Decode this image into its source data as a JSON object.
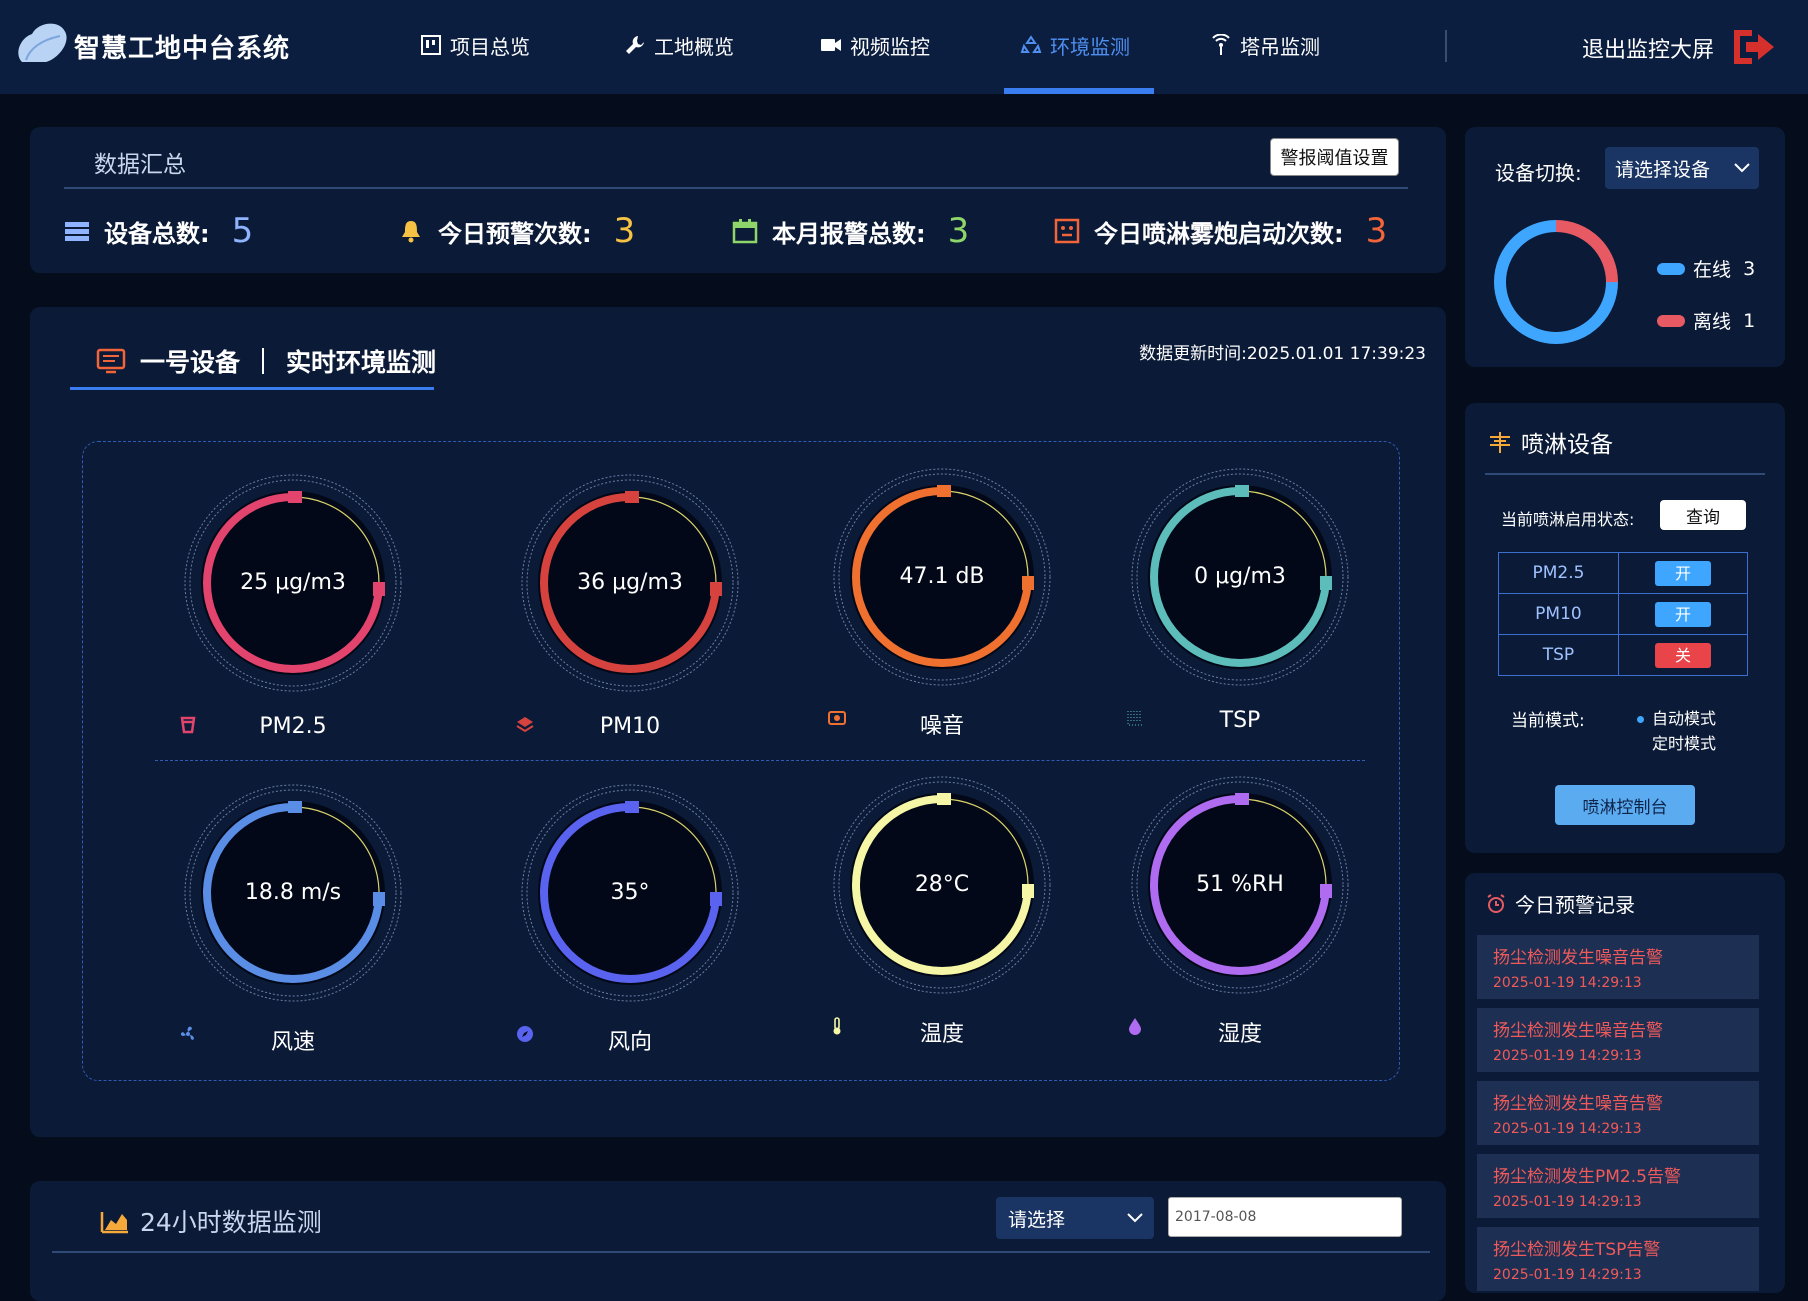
{
  "app": {
    "title": "智慧工地中台系统"
  },
  "nav": [
    {
      "label": "项目总览",
      "icon": "board-icon",
      "active": false
    },
    {
      "label": "工地概览",
      "icon": "wrench-icon",
      "active": false
    },
    {
      "label": "视频监控",
      "icon": "video-icon",
      "active": false
    },
    {
      "label": "环境监测",
      "icon": "recycle-icon",
      "active": true
    },
    {
      "label": "塔吊监测",
      "icon": "signal-icon",
      "active": false
    }
  ],
  "exit_label": "退出监控大屏",
  "summary": {
    "title": "数据汇总",
    "threshold_button": "警报阈值设置",
    "stats": [
      {
        "label": "设备总数:",
        "value": "5",
        "color": "#8fb3ff",
        "icon": "list-icon"
      },
      {
        "label": "今日预警次数:",
        "value": "3",
        "color": "#f6c244",
        "icon": "bell-icon"
      },
      {
        "label": "本月报警总数:",
        "value": "3",
        "color": "#8ed66a",
        "icon": "calendar-icon"
      },
      {
        "label": "今日喷淋雾炮启动次数:",
        "value": "3",
        "color": "#f2653b",
        "icon": "face-icon"
      }
    ]
  },
  "monitor": {
    "device": "一号设备",
    "title": "实时环境监测",
    "update_time": "数据更新时间:2025.01.01 17:39:23",
    "gauges": [
      {
        "value": "25 μg/m3",
        "label": "PM2.5",
        "color": "#e2446e",
        "icon": "cup-icon"
      },
      {
        "value": "36 μg/m3",
        "label": "PM10",
        "color": "#d6433f",
        "icon": "layers-icon"
      },
      {
        "value": "47.1 dB",
        "label": "噪音",
        "color": "#f0702f",
        "icon": "speaker-icon"
      },
      {
        "value": "0 μg/m3",
        "label": "TSP",
        "color": "#5dbdbb",
        "icon": "grid-icon"
      },
      {
        "value": "18.8  m/s",
        "label": "风速",
        "color": "#5a8ee6",
        "icon": "fan-icon"
      },
      {
        "value": "35°",
        "label": "风向",
        "color": "#5a63ef",
        "icon": "compass-icon"
      },
      {
        "value": "28°C",
        "label": "温度",
        "color": "#f6f7a6",
        "icon": "thermometer-icon"
      },
      {
        "value": "51 %RH",
        "label": "湿度",
        "color": "#b06cf0",
        "icon": "drop-icon"
      }
    ]
  },
  "h24": {
    "title": "24小时数据监测",
    "select_placeholder": "请选择",
    "date": "2017-08-08"
  },
  "device_switch": {
    "label": "设备切换:",
    "select": "请选择设备",
    "online_label": "在线",
    "online": 3,
    "offline_label": "离线",
    "offline": 1,
    "online_color": "#3fa6ff",
    "offline_color": "#e85a63"
  },
  "spray": {
    "title": "喷淋设备",
    "status_label": "当前喷淋启用状态:",
    "query": "查询",
    "rows": [
      {
        "name": "PM2.5",
        "state": "开",
        "on": true
      },
      {
        "name": "PM10",
        "state": "开",
        "on": true
      },
      {
        "name": "TSP",
        "state": "关",
        "on": false
      }
    ],
    "mode_label": "当前模式:",
    "modes": [
      "自动模式",
      "定时模式"
    ],
    "console": "喷淋控制台"
  },
  "alerts": {
    "title": "今日预警记录",
    "items": [
      {
        "text": "扬尘检测发生噪音告警",
        "time": "2025-01-19 14:29:13"
      },
      {
        "text": "扬尘检测发生噪音告警",
        "time": "2025-01-19 14:29:13"
      },
      {
        "text": "扬尘检测发生噪音告警",
        "time": "2025-01-19 14:29:13"
      },
      {
        "text": "扬尘检测发生PM2.5告警",
        "time": "2025-01-19 14:29:13"
      },
      {
        "text": "扬尘检测发生TSP告警",
        "time": "2025-01-19 14:29:13"
      }
    ]
  }
}
